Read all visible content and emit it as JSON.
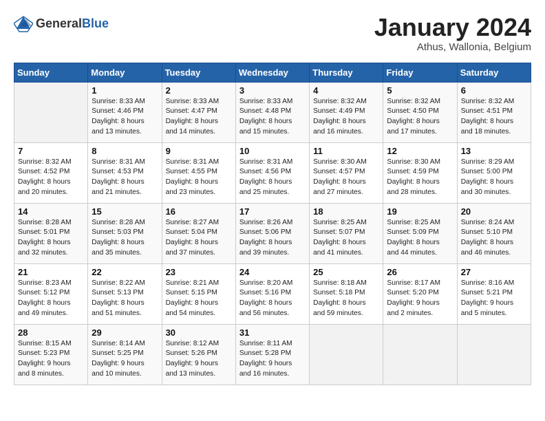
{
  "logo": {
    "general": "General",
    "blue": "Blue"
  },
  "header": {
    "month": "January 2024",
    "location": "Athus, Wallonia, Belgium"
  },
  "days_header": [
    "Sunday",
    "Monday",
    "Tuesday",
    "Wednesday",
    "Thursday",
    "Friday",
    "Saturday"
  ],
  "weeks": [
    [
      {
        "day": "",
        "info": ""
      },
      {
        "day": "1",
        "info": "Sunrise: 8:33 AM\nSunset: 4:46 PM\nDaylight: 8 hours\nand 13 minutes."
      },
      {
        "day": "2",
        "info": "Sunrise: 8:33 AM\nSunset: 4:47 PM\nDaylight: 8 hours\nand 14 minutes."
      },
      {
        "day": "3",
        "info": "Sunrise: 8:33 AM\nSunset: 4:48 PM\nDaylight: 8 hours\nand 15 minutes."
      },
      {
        "day": "4",
        "info": "Sunrise: 8:32 AM\nSunset: 4:49 PM\nDaylight: 8 hours\nand 16 minutes."
      },
      {
        "day": "5",
        "info": "Sunrise: 8:32 AM\nSunset: 4:50 PM\nDaylight: 8 hours\nand 17 minutes."
      },
      {
        "day": "6",
        "info": "Sunrise: 8:32 AM\nSunset: 4:51 PM\nDaylight: 8 hours\nand 18 minutes."
      }
    ],
    [
      {
        "day": "7",
        "info": "Sunrise: 8:32 AM\nSunset: 4:52 PM\nDaylight: 8 hours\nand 20 minutes."
      },
      {
        "day": "8",
        "info": "Sunrise: 8:31 AM\nSunset: 4:53 PM\nDaylight: 8 hours\nand 21 minutes."
      },
      {
        "day": "9",
        "info": "Sunrise: 8:31 AM\nSunset: 4:55 PM\nDaylight: 8 hours\nand 23 minutes."
      },
      {
        "day": "10",
        "info": "Sunrise: 8:31 AM\nSunset: 4:56 PM\nDaylight: 8 hours\nand 25 minutes."
      },
      {
        "day": "11",
        "info": "Sunrise: 8:30 AM\nSunset: 4:57 PM\nDaylight: 8 hours\nand 27 minutes."
      },
      {
        "day": "12",
        "info": "Sunrise: 8:30 AM\nSunset: 4:59 PM\nDaylight: 8 hours\nand 28 minutes."
      },
      {
        "day": "13",
        "info": "Sunrise: 8:29 AM\nSunset: 5:00 PM\nDaylight: 8 hours\nand 30 minutes."
      }
    ],
    [
      {
        "day": "14",
        "info": "Sunrise: 8:28 AM\nSunset: 5:01 PM\nDaylight: 8 hours\nand 32 minutes."
      },
      {
        "day": "15",
        "info": "Sunrise: 8:28 AM\nSunset: 5:03 PM\nDaylight: 8 hours\nand 35 minutes."
      },
      {
        "day": "16",
        "info": "Sunrise: 8:27 AM\nSunset: 5:04 PM\nDaylight: 8 hours\nand 37 minutes."
      },
      {
        "day": "17",
        "info": "Sunrise: 8:26 AM\nSunset: 5:06 PM\nDaylight: 8 hours\nand 39 minutes."
      },
      {
        "day": "18",
        "info": "Sunrise: 8:25 AM\nSunset: 5:07 PM\nDaylight: 8 hours\nand 41 minutes."
      },
      {
        "day": "19",
        "info": "Sunrise: 8:25 AM\nSunset: 5:09 PM\nDaylight: 8 hours\nand 44 minutes."
      },
      {
        "day": "20",
        "info": "Sunrise: 8:24 AM\nSunset: 5:10 PM\nDaylight: 8 hours\nand 46 minutes."
      }
    ],
    [
      {
        "day": "21",
        "info": "Sunrise: 8:23 AM\nSunset: 5:12 PM\nDaylight: 8 hours\nand 49 minutes."
      },
      {
        "day": "22",
        "info": "Sunrise: 8:22 AM\nSunset: 5:13 PM\nDaylight: 8 hours\nand 51 minutes."
      },
      {
        "day": "23",
        "info": "Sunrise: 8:21 AM\nSunset: 5:15 PM\nDaylight: 8 hours\nand 54 minutes."
      },
      {
        "day": "24",
        "info": "Sunrise: 8:20 AM\nSunset: 5:16 PM\nDaylight: 8 hours\nand 56 minutes."
      },
      {
        "day": "25",
        "info": "Sunrise: 8:18 AM\nSunset: 5:18 PM\nDaylight: 8 hours\nand 59 minutes."
      },
      {
        "day": "26",
        "info": "Sunrise: 8:17 AM\nSunset: 5:20 PM\nDaylight: 9 hours\nand 2 minutes."
      },
      {
        "day": "27",
        "info": "Sunrise: 8:16 AM\nSunset: 5:21 PM\nDaylight: 9 hours\nand 5 minutes."
      }
    ],
    [
      {
        "day": "28",
        "info": "Sunrise: 8:15 AM\nSunset: 5:23 PM\nDaylight: 9 hours\nand 8 minutes."
      },
      {
        "day": "29",
        "info": "Sunrise: 8:14 AM\nSunset: 5:25 PM\nDaylight: 9 hours\nand 10 minutes."
      },
      {
        "day": "30",
        "info": "Sunrise: 8:12 AM\nSunset: 5:26 PM\nDaylight: 9 hours\nand 13 minutes."
      },
      {
        "day": "31",
        "info": "Sunrise: 8:11 AM\nSunset: 5:28 PM\nDaylight: 9 hours\nand 16 minutes."
      },
      {
        "day": "",
        "info": ""
      },
      {
        "day": "",
        "info": ""
      },
      {
        "day": "",
        "info": ""
      }
    ]
  ]
}
